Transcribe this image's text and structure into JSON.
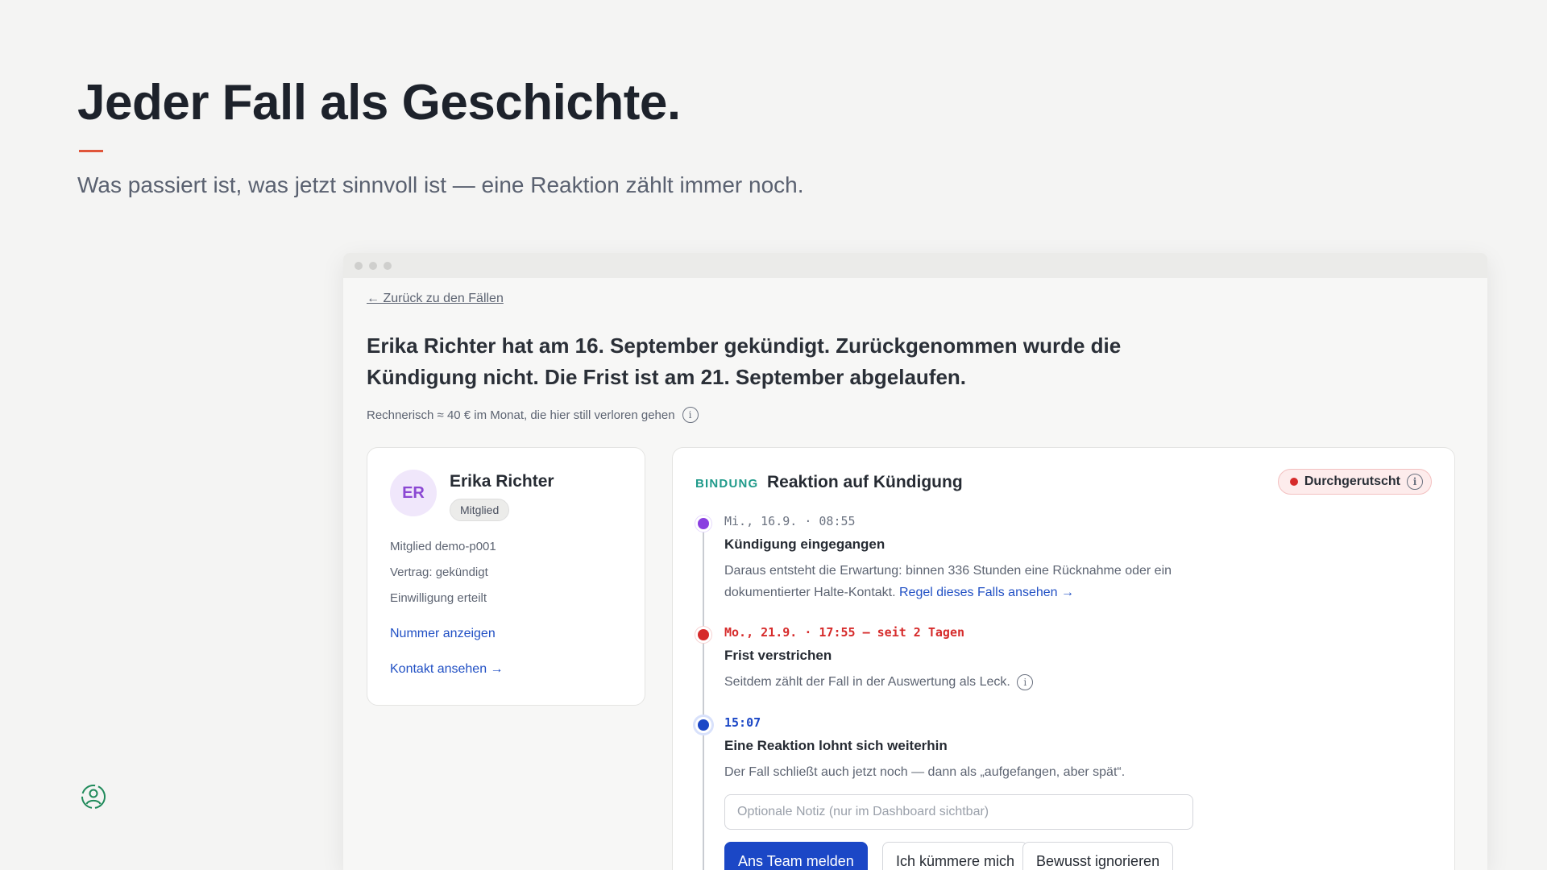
{
  "slide": {
    "title": "Jeder Fall als Geschichte.",
    "subtitle": "Was passiert ist, was jetzt sinnvoll ist — eine Reaktion zählt immer noch.",
    "accent_color": "#e0553a"
  },
  "window": {
    "back_link": "← Zurück zu den Fällen",
    "headline": "Erika Richter hat am 16. September gekündigt. Zurückgenommen wurde die Kündigung nicht. Die Frist ist am 21. September abgelaufen.",
    "loss_note": "Rechnerisch ≈ 40 € im Monat, die hier still verloren gehen"
  },
  "person": {
    "initials": "ER",
    "name": "Erika Richter",
    "role": "Mitglied",
    "facts": [
      "Mitglied demo-p001",
      "Vertrag: gekündigt",
      "Einwilligung erteilt"
    ],
    "show_number": "Nummer anzeigen",
    "view_contact": "Kontakt ansehen →"
  },
  "timeline": {
    "category": "BINDUNG",
    "title": "Reaktion auf Kündigung",
    "status": "Durchgerutscht",
    "status_color": "#d62b2b",
    "events": [
      {
        "time": "Mi., 16.9. · 08:55",
        "title": "Kündigung eingegangen",
        "desc": "Daraus entsteht die Erwartung: binnen 336 Stunden eine Rücknahme oder ein dokumentierter Halte-Kontakt.",
        "link": "Regel dieses Falls ansehen →"
      },
      {
        "time": "Mo., 21.9. · 17:55 — seit 2 Tagen",
        "title": "Frist verstrichen",
        "desc": "Seitdem zählt der Fall in der Auswertung als Leck."
      },
      {
        "time": "15:07",
        "title": "Eine Reaktion lohnt sich weiterhin",
        "desc": "Der Fall schließt auch jetzt noch — dann als „aufgefangen, aber spät“."
      }
    ],
    "note_placeholder": "Optionale Notiz (nur im Dashboard sichtbar)",
    "note_value": "",
    "buttons": {
      "report": "Ans Team melden",
      "handle": "Ich kümmere mich",
      "ignore": "Bewusst ignorieren"
    }
  }
}
